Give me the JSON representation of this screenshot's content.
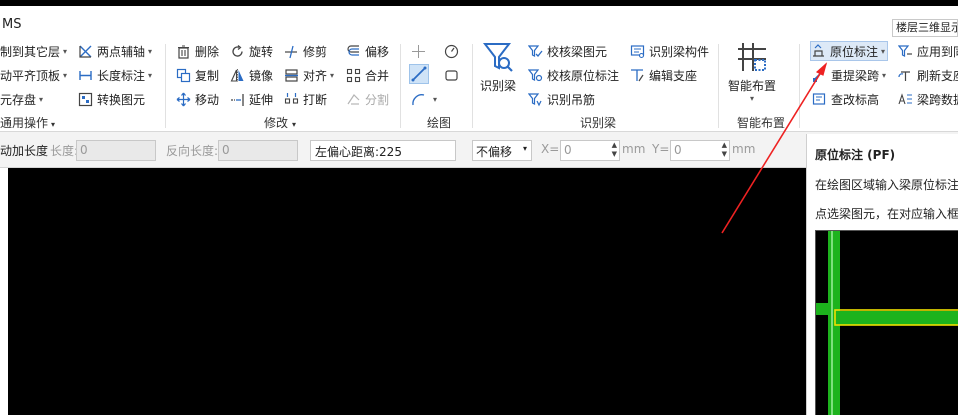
{
  "app": {
    "title": "MS",
    "floor_3d_label": "楼层三维显示"
  },
  "ribbon": {
    "general": {
      "label": "通用操作",
      "items": [
        {
          "label": "制到其它层",
          "dropdown": true
        },
        {
          "label": "动平齐顶板",
          "dropdown": true
        },
        {
          "label": "元存盘",
          "dropdown": true
        }
      ],
      "items2": [
        {
          "label": "两点辅轴",
          "dropdown": true
        },
        {
          "label": "长度标注",
          "dropdown": true
        },
        {
          "label": "转换图元",
          "dropdown": false
        }
      ]
    },
    "modify": {
      "label": "修改",
      "col1": [
        {
          "label": "删除"
        },
        {
          "label": "复制"
        },
        {
          "label": "移动"
        }
      ],
      "col2": [
        {
          "label": "旋转"
        },
        {
          "label": "镜像"
        },
        {
          "label": "延伸"
        }
      ],
      "col3": [
        {
          "label": "修剪"
        },
        {
          "label": "对齐",
          "dropdown": true
        },
        {
          "label": "打断"
        }
      ],
      "col4": [
        {
          "label": "偏移"
        },
        {
          "label": "合并"
        },
        {
          "label": "分割",
          "disabled": true
        }
      ]
    },
    "draw": {
      "label": "绘图"
    },
    "recognize_beam": {
      "label": "识别梁",
      "big_button": "识别梁",
      "items": [
        {
          "label": "校核梁图元"
        },
        {
          "label": "校核原位标注"
        },
        {
          "label": "识别吊筋"
        }
      ],
      "items2": [
        {
          "label": "识别梁构件"
        },
        {
          "label": "编辑支座"
        }
      ]
    },
    "smart_layout": {
      "label": "智能布置",
      "big_button": "智能布置"
    },
    "beam_ops": {
      "items": [
        {
          "label": "原位标注",
          "dropdown": true
        },
        {
          "label": "重提梁跨",
          "dropdown": true
        },
        {
          "label": "查改标高"
        }
      ],
      "items2": [
        {
          "label": "应用到同"
        },
        {
          "label": "刷新支座"
        },
        {
          "label": "梁跨数据"
        }
      ]
    }
  },
  "optionbar": {
    "length_label": "动加长度",
    "length_field_label": "长度:",
    "length_value": "0",
    "reverse_length_label": "反向长度:",
    "reverse_length_value": "0",
    "left_offset_label": "左偏心距离:",
    "left_offset_value": "225",
    "offset_mode": "不偏移",
    "x_label": "X=",
    "x_value": "0",
    "y_label": "Y=",
    "y_value": "0",
    "unit": "mm"
  },
  "tooltip": {
    "title": "原位标注 (PF)",
    "line1": "在绘图区域输入梁原位标注",
    "line2": "点选梁图元，在对应输入框"
  },
  "colors": {
    "canvas_bg": "#000000",
    "accent_blue": "#2b6cc4",
    "preview_green": "#1db31d",
    "preview_highlight": "#f0e000",
    "annotation_arrow": "#ee2222"
  }
}
